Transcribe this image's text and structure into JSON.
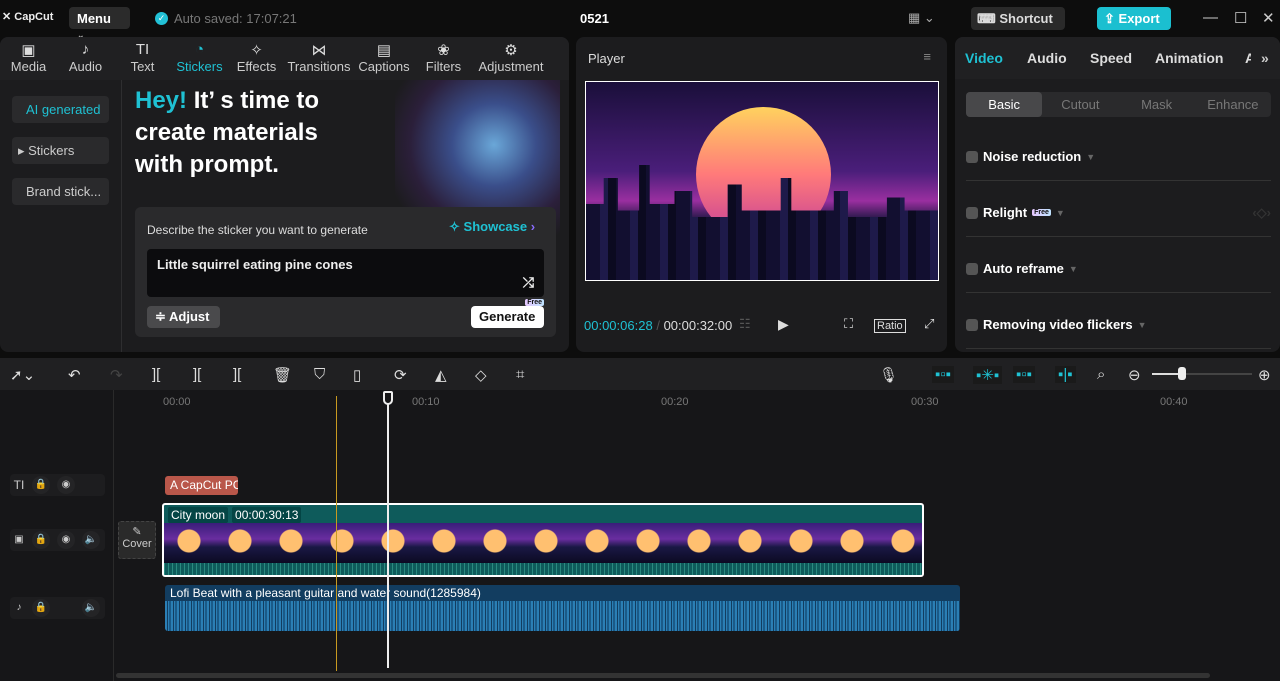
{
  "topbar": {
    "logo": "CapCut",
    "menu": "Menu",
    "autosave": "Auto saved: 17:07:21",
    "project": "0521",
    "shortcut": "Shortcut",
    "export": "Export"
  },
  "tabs": [
    {
      "label": "Media",
      "icon": "▣"
    },
    {
      "label": "Audio",
      "icon": "♪"
    },
    {
      "label": "Text",
      "icon": "TI"
    },
    {
      "label": "Stickers",
      "icon": "◔"
    },
    {
      "label": "Effects",
      "icon": "✧"
    },
    {
      "label": "Transitions",
      "icon": "⋈"
    },
    {
      "label": "Captions",
      "icon": "▤"
    },
    {
      "label": "Filters",
      "icon": "❀"
    },
    {
      "label": "Adjustment",
      "icon": "⚙"
    }
  ],
  "sidebar": [
    "AI generated",
    "▸ Stickers",
    "Brand stick..."
  ],
  "hero": {
    "accent": "Hey!",
    "line1": " It’ s time to",
    "line2": "create materials",
    "line3": "with prompt."
  },
  "generator": {
    "label": "Describe the sticker you want to generate",
    "showcase": "Showcase",
    "prompt": "Little squirrel eating pine cones",
    "adjust": "Adjust",
    "generate": "Generate",
    "free": "Free"
  },
  "player": {
    "title": "Player",
    "current": "00:00:06:28",
    "total": "00:00:32:00",
    "ratio": "Ratio"
  },
  "right": {
    "tabs": [
      "Video",
      "Audio",
      "Speed",
      "Animation",
      "A"
    ],
    "subtabs": [
      "Basic",
      "Cutout",
      "Mask",
      "Enhance"
    ],
    "options": [
      "Noise reduction",
      "Relight",
      "Auto reframe",
      "Removing video flickers"
    ],
    "free": "Free"
  },
  "timeline": {
    "ticks": [
      "00:00",
      "00:10",
      "00:20",
      "00:30",
      "00:40"
    ],
    "text_clip": "A CapCut PC",
    "video_clip": "City moon",
    "video_duration": "00:00:30:13",
    "audio_clip": "Lofi Beat with a pleasant guitar and water sound(1285984)",
    "cover": "Cover",
    "zoom_level": 0.3
  },
  "colors": {
    "accent": "#1fc1d3"
  }
}
